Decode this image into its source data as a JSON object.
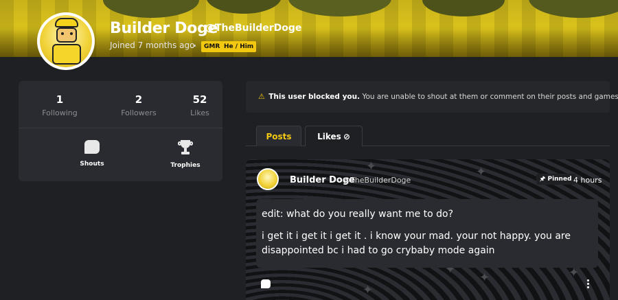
{
  "profile": {
    "display_name": "Builder Doge",
    "handle": "@TheBuilderDoge",
    "joined": "Joined 7 months ago",
    "badges": [
      "GMR",
      "He / Him"
    ]
  },
  "stats": {
    "following": {
      "value": "1",
      "label": "Following"
    },
    "followers": {
      "value": "2",
      "label": "Followers"
    },
    "likes": {
      "value": "52",
      "label": "Likes"
    }
  },
  "actions": {
    "shouts_label": "Shouts",
    "trophies_label": "Trophies"
  },
  "notice": {
    "bold": "This user blocked you.",
    "text": " You are unable to shout at them or comment on their posts and games."
  },
  "tabs": {
    "posts": "Posts",
    "likes": "Likes"
  },
  "post": {
    "author": "Builder Doge",
    "handle": "@TheBuilderDoge",
    "pinned": "Pinned",
    "time": "4 hours",
    "line1": "edit: what do you really want me to do?",
    "line2": "i get it i get it i get it . i know your mad. your not happy. you are disappointed bc i had to go crybaby mode again"
  },
  "colors": {
    "accent": "#f2c811",
    "background": "#1f2024",
    "card": "#2a2b30"
  },
  "icons": {
    "warning": "warning-icon",
    "shouts": "chat-bubble-icon",
    "trophies": "trophy-icon",
    "likes_hidden": "eye-slash-icon",
    "pin": "pin-icon",
    "reply": "comment-icon",
    "more": "kebab-menu-icon"
  }
}
